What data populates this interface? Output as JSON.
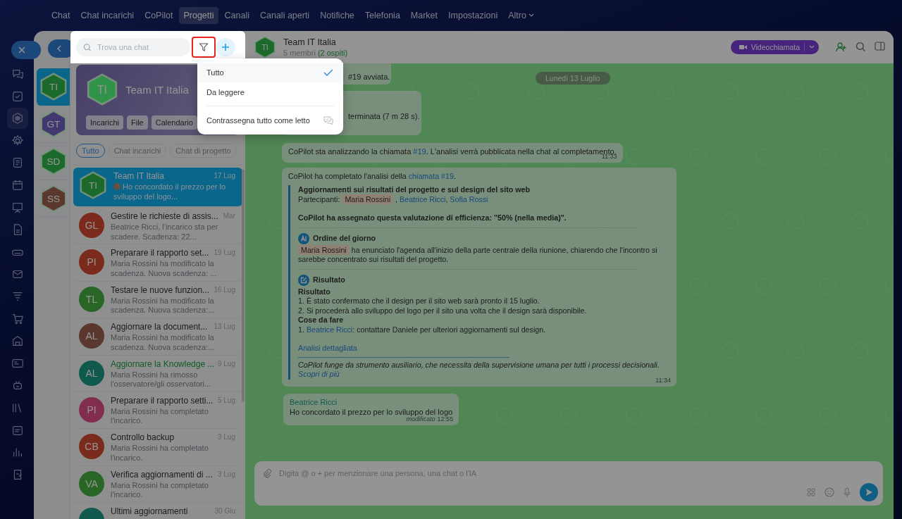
{
  "top_nav": {
    "items": [
      {
        "label": "Chat",
        "selected": false
      },
      {
        "label": "Chat incarichi",
        "selected": false
      },
      {
        "label": "CoPilot",
        "selected": false
      },
      {
        "label": "Progetti",
        "selected": true
      },
      {
        "label": "Canali",
        "selected": false
      },
      {
        "label": "Canali aperti",
        "selected": false
      },
      {
        "label": "Notifiche",
        "selected": false
      },
      {
        "label": "Telefonia",
        "selected": false
      },
      {
        "label": "Market",
        "selected": false
      },
      {
        "label": "Impostazioni",
        "selected": false
      },
      {
        "label": "Altro",
        "selected": false,
        "kind": "dropdown"
      }
    ]
  },
  "rail": {
    "items": [
      {
        "selected": false
      },
      {
        "selected": false
      },
      {
        "selected": true
      },
      {
        "selected": false
      },
      {
        "selected": false
      },
      {
        "selected": false
      },
      {
        "selected": false
      },
      {
        "selected": false
      },
      {
        "selected": false
      },
      {
        "selected": false
      },
      {
        "selected": false
      },
      {
        "selected": false
      },
      {
        "selected": false
      },
      {
        "selected": false
      },
      {
        "selected": false
      },
      {
        "selected": false
      },
      {
        "selected": false
      },
      {
        "selected": false
      },
      {
        "selected": false
      }
    ]
  },
  "projects": [
    {
      "initials": "TI",
      "color": "#1b6a2b",
      "selected": true
    },
    {
      "initials": "GT",
      "color": "#40386e",
      "selected": false
    },
    {
      "initials": "SD",
      "color": "#1b6a2b",
      "selected": false
    },
    {
      "initials": "SS",
      "color": "#5a382e",
      "selected": false
    }
  ],
  "search": {
    "placeholder": "Trova una chat"
  },
  "filter_menu": {
    "options": [
      {
        "label": "Tutto",
        "selected": true
      },
      {
        "label": "Da leggere",
        "selected": false
      }
    ],
    "action": "Contrassegna tutto come letto"
  },
  "project_card": {
    "initials": "TI",
    "title": "Team IT Italia",
    "buttons": [
      "Incarichi",
      "File",
      "Calendario"
    ]
  },
  "chips": [
    {
      "label": "Tutto",
      "selected": true
    },
    {
      "label": "Chat incarichi",
      "selected": false
    },
    {
      "label": "Chat di progetto",
      "selected": false
    }
  ],
  "chats": [
    {
      "kind": "project",
      "initials": "TI",
      "color": "#1b6a2b",
      "title": "Team IT Italia",
      "date": "17 Lug",
      "preview": "Ho concordato il prezzo per lo sviluppo del logo...",
      "sender_avatar": true,
      "selected": true,
      "highlighted": false
    },
    {
      "kind": "task",
      "initials": "GL",
      "color": "#7b2b1b",
      "title": "Gestire le richieste di assis...",
      "date": "Mar",
      "preview": "Beatrice Ricci, l'incarico sta per scadere. Scadenza: 22...",
      "selected": false,
      "highlighted": false
    },
    {
      "kind": "task",
      "initials": "PI",
      "color": "#7b2b1b",
      "title": "Preparare il rapporto set...",
      "date": "19 Lug",
      "preview": "Maria Rossini ha modificato la scadenza. Nuova scadenza: ...",
      "selected": false,
      "highlighted": false
    },
    {
      "kind": "task",
      "initials": "TL",
      "color": "#2a6627",
      "title": "Testare le nuove funzion...",
      "date": "16 Lug",
      "preview": "Maria Rossini ha modificato la scadenza. Nuova scadenza:...",
      "selected": false,
      "highlighted": false
    },
    {
      "kind": "task",
      "initials": "AL",
      "color": "#5a382e",
      "title": "Aggiornare la document...",
      "date": "13 Lug",
      "preview": "Maria Rossini ha modificato la scadenza. Nuova scadenza:...",
      "selected": false,
      "highlighted": false
    },
    {
      "kind": "task",
      "initials": "AL",
      "color": "#10594e",
      "title": "Aggiornare la Knowledge ...",
      "date": "9 Lug",
      "preview": "Maria Rossini ha rimosso l'osservatore/gli osservatori...",
      "selected": false,
      "highlighted": true
    },
    {
      "kind": "task",
      "initials": "PI",
      "color": "#822d4f",
      "title": "Preparare il rapporto setti...",
      "date": "5 Lug",
      "preview": "Maria Rossini ha completato l'incarico.",
      "selected": false,
      "highlighted": false
    },
    {
      "kind": "task",
      "initials": "CB",
      "color": "#7b2b1b",
      "title": "Controllo backup",
      "date": "3 Lug",
      "preview": "Maria Rossini ha completato l'incarico.",
      "selected": false,
      "highlighted": false
    },
    {
      "kind": "task",
      "initials": "VA",
      "color": "#2a6627",
      "title": "Verifica aggiornamenti di ...",
      "date": "3 Lug",
      "preview": "Maria Rossini ha completato l'incarico.",
      "selected": false,
      "highlighted": false
    },
    {
      "kind": "task",
      "color": "#10594e",
      "title": "Ultimi aggiornamenti",
      "date": "30 Giu",
      "selected": false,
      "highlighted": false
    }
  ],
  "chat": {
    "initials": "TI",
    "color": "#1b6a2b",
    "title": "Team IT Italia",
    "members": "5 membri",
    "guests": "(2 ospiti)",
    "video_button": "Videochiamata",
    "date_divider": "Lunedì 13 Luglio",
    "messages": [
      {
        "kind": "partial",
        "text": "#19 avviata."
      },
      {
        "kind": "partial",
        "text": "terminata (7 m 28 s)."
      },
      {
        "kind": "system",
        "segments": [
          {
            "kind": "text",
            "text": "CoPilot sta analizzando la chiamata "
          },
          {
            "kind": "link",
            "text": "#19"
          },
          {
            "kind": "text",
            "text": ". L'analisi verrà pubblicata nella chat al completamento."
          }
        ],
        "time": "11:33"
      },
      {
        "kind": "analysis",
        "segments": [
          {
            "kind": "text",
            "text": "CoPilot ha completato l'analisi della "
          },
          {
            "kind": "link",
            "text": "chiamata #19"
          },
          {
            "kind": "text",
            "text": "."
          }
        ],
        "title": "Aggiornamenti sui risultati del progetto e sul design del sito web",
        "participants": [
          {
            "kind": "text",
            "text": "Partecipanti: "
          },
          {
            "kind": "mention",
            "text": "Maria Rossini"
          },
          {
            "kind": "text",
            "text": " , "
          },
          {
            "kind": "link",
            "text": "Beatrice Ricci"
          },
          {
            "kind": "text",
            "text": ", "
          },
          {
            "kind": "link",
            "text": "Sofia Rossi"
          }
        ],
        "rating": "CoPilot ha assegnato questa valutazione di efficienza: \"50% (nella media)\".",
        "sections": [
          {
            "kind": "agenda",
            "heading": "Ordine del giorno",
            "lines": [
              {
                "kind": "text",
                "segments": [
                  {
                    "kind": "mention",
                    "text": "Maria Rossini"
                  },
                  {
                    "kind": "text",
                    "text": " ha enunciato l'agenda all'inizio della parte centrale della riunione, chiarendo che l'incontro si sarebbe concentrato sui risultati del progetto."
                  }
                ]
              }
            ]
          },
          {
            "kind": "result",
            "heading": "Risultato",
            "lines": [
              {
                "kind": "bold",
                "segments": [
                  {
                    "kind": "text",
                    "text": "Risultato"
                  }
                ]
              },
              {
                "kind": "text",
                "segments": [
                  {
                    "kind": "text",
                    "text": "1. È stato confermato che il design per il sito web sarà pronto il 15 luglio."
                  }
                ]
              },
              {
                "kind": "text",
                "segments": [
                  {
                    "kind": "text",
                    "text": "2. Si procederà allo sviluppo del logo per il sito una volta che il design sarà disponibile."
                  }
                ]
              },
              {
                "kind": "bold",
                "segments": [
                  {
                    "kind": "text",
                    "text": "Cose da fare"
                  }
                ]
              },
              {
                "kind": "text",
                "segments": [
                  {
                    "kind": "text",
                    "text": "1. "
                  },
                  {
                    "kind": "link",
                    "text": "Beatrice Ricci"
                  },
                  {
                    "kind": "text",
                    "text": ": contattare Daniele per ulteriori aggiornamenti sul design."
                  }
                ]
              }
            ]
          }
        ],
        "details_link": "Analisi dettagliata",
        "disclaimer": "CoPilot funge da strumento ausiliario, che necessita della supervisione umana per tutti i processi decisionali.",
        "more_link": "Scopri di più",
        "time": "11:34"
      },
      {
        "kind": "user",
        "author": "Beatrice Ricci",
        "text": "Ho concordato il prezzo per lo sviluppo del logo",
        "edited": "modificato",
        "time": "12:55"
      }
    ],
    "composer": {
      "placeholder": "Digita @ o + per menzionare una persona, una chat o l'IA"
    }
  }
}
